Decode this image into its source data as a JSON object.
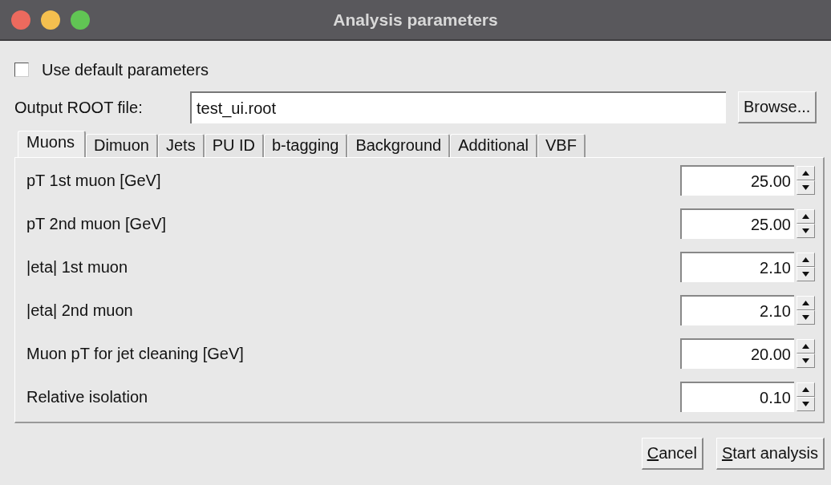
{
  "window": {
    "title": "Analysis parameters"
  },
  "use_default": {
    "label": "Use default parameters",
    "checked": false
  },
  "output": {
    "label": "Output ROOT file:",
    "value": "test_ui.root",
    "browse": "Browse..."
  },
  "tabs": [
    {
      "label": "Muons",
      "selected": true
    },
    {
      "label": "Dimuon",
      "selected": false
    },
    {
      "label": "Jets",
      "selected": false
    },
    {
      "label": "PU ID",
      "selected": false
    },
    {
      "label": "b-tagging",
      "selected": false
    },
    {
      "label": "Background",
      "selected": false
    },
    {
      "label": "Additional",
      "selected": false
    },
    {
      "label": "VBF",
      "selected": false
    }
  ],
  "parameters": [
    {
      "label": "pT 1st muon [GeV]",
      "value": "25.00"
    },
    {
      "label": "pT 2nd muon [GeV]",
      "value": "25.00"
    },
    {
      "label": "|eta| 1st muon",
      "value": "2.10"
    },
    {
      "label": "|eta| 2nd muon",
      "value": "2.10"
    },
    {
      "label": "Muon pT for jet cleaning [GeV]",
      "value": "20.00"
    },
    {
      "label": "Relative isolation",
      "value": "0.10"
    }
  ],
  "buttons": [
    {
      "label": "Cancel",
      "first_letter_underlined": true
    },
    {
      "label": "Start analysis",
      "first_letter_underlined": true
    }
  ]
}
